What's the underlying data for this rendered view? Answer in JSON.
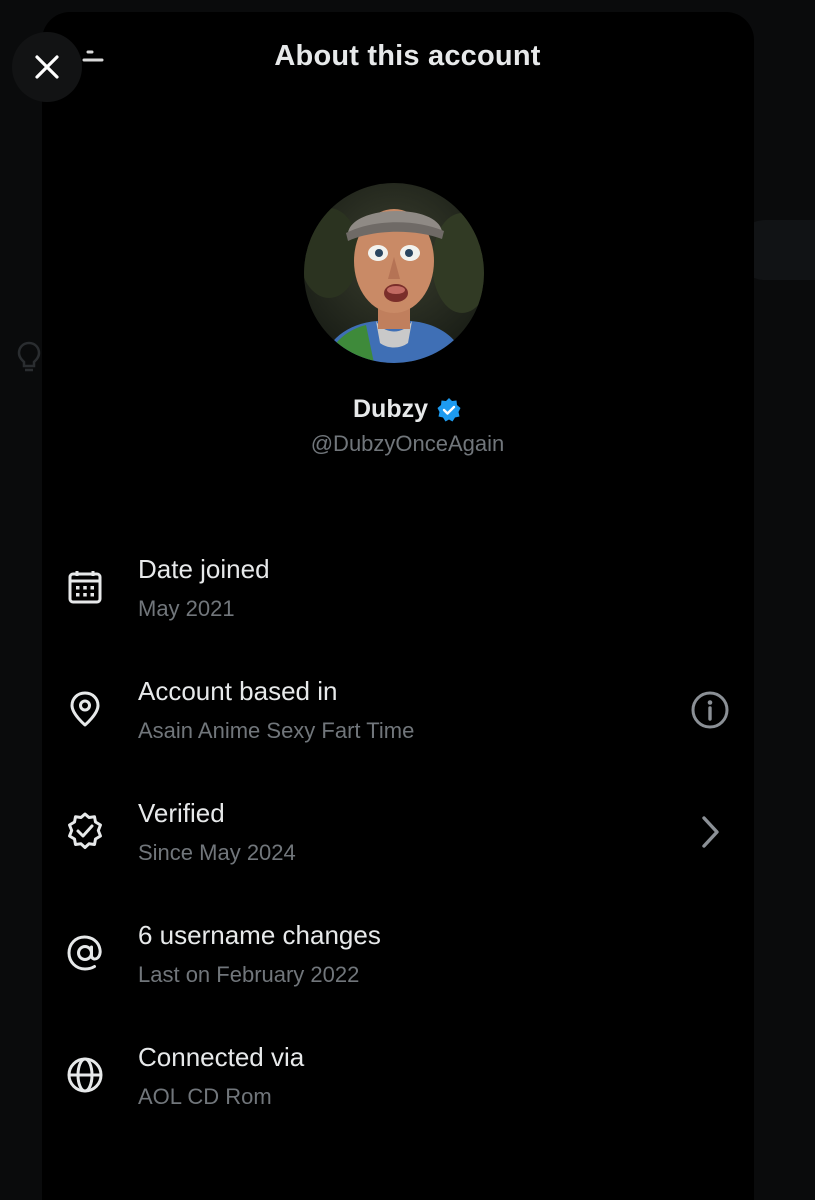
{
  "header": {
    "title": "About this account",
    "close_icon": "close-icon"
  },
  "profile": {
    "display_name": "Dubzy",
    "handle": "@DubzyOnceAgain",
    "verified_badge_color": "#1d9bf0"
  },
  "rows": [
    {
      "icon": "calendar-icon",
      "title": "Date joined",
      "subtitle": "May 2021"
    },
    {
      "icon": "location-pin-icon",
      "title": "Account based in",
      "subtitle": "Asain Anime Sexy Fart Time",
      "action_icon": "info-icon"
    },
    {
      "icon": "verified-badge-icon",
      "title": "Verified",
      "subtitle": "Since May 2024",
      "action_icon": "chevron-right-icon"
    },
    {
      "icon": "at-sign-icon",
      "title": "6 username changes",
      "subtitle": "Last on February 2022"
    },
    {
      "icon": "globe-icon",
      "title": "Connected via",
      "subtitle": "AOL CD Rom"
    }
  ],
  "colors": {
    "background": "#000000",
    "primary_text": "#e7e9ea",
    "secondary_text": "#71767b",
    "accent": "#1d9bf0"
  }
}
